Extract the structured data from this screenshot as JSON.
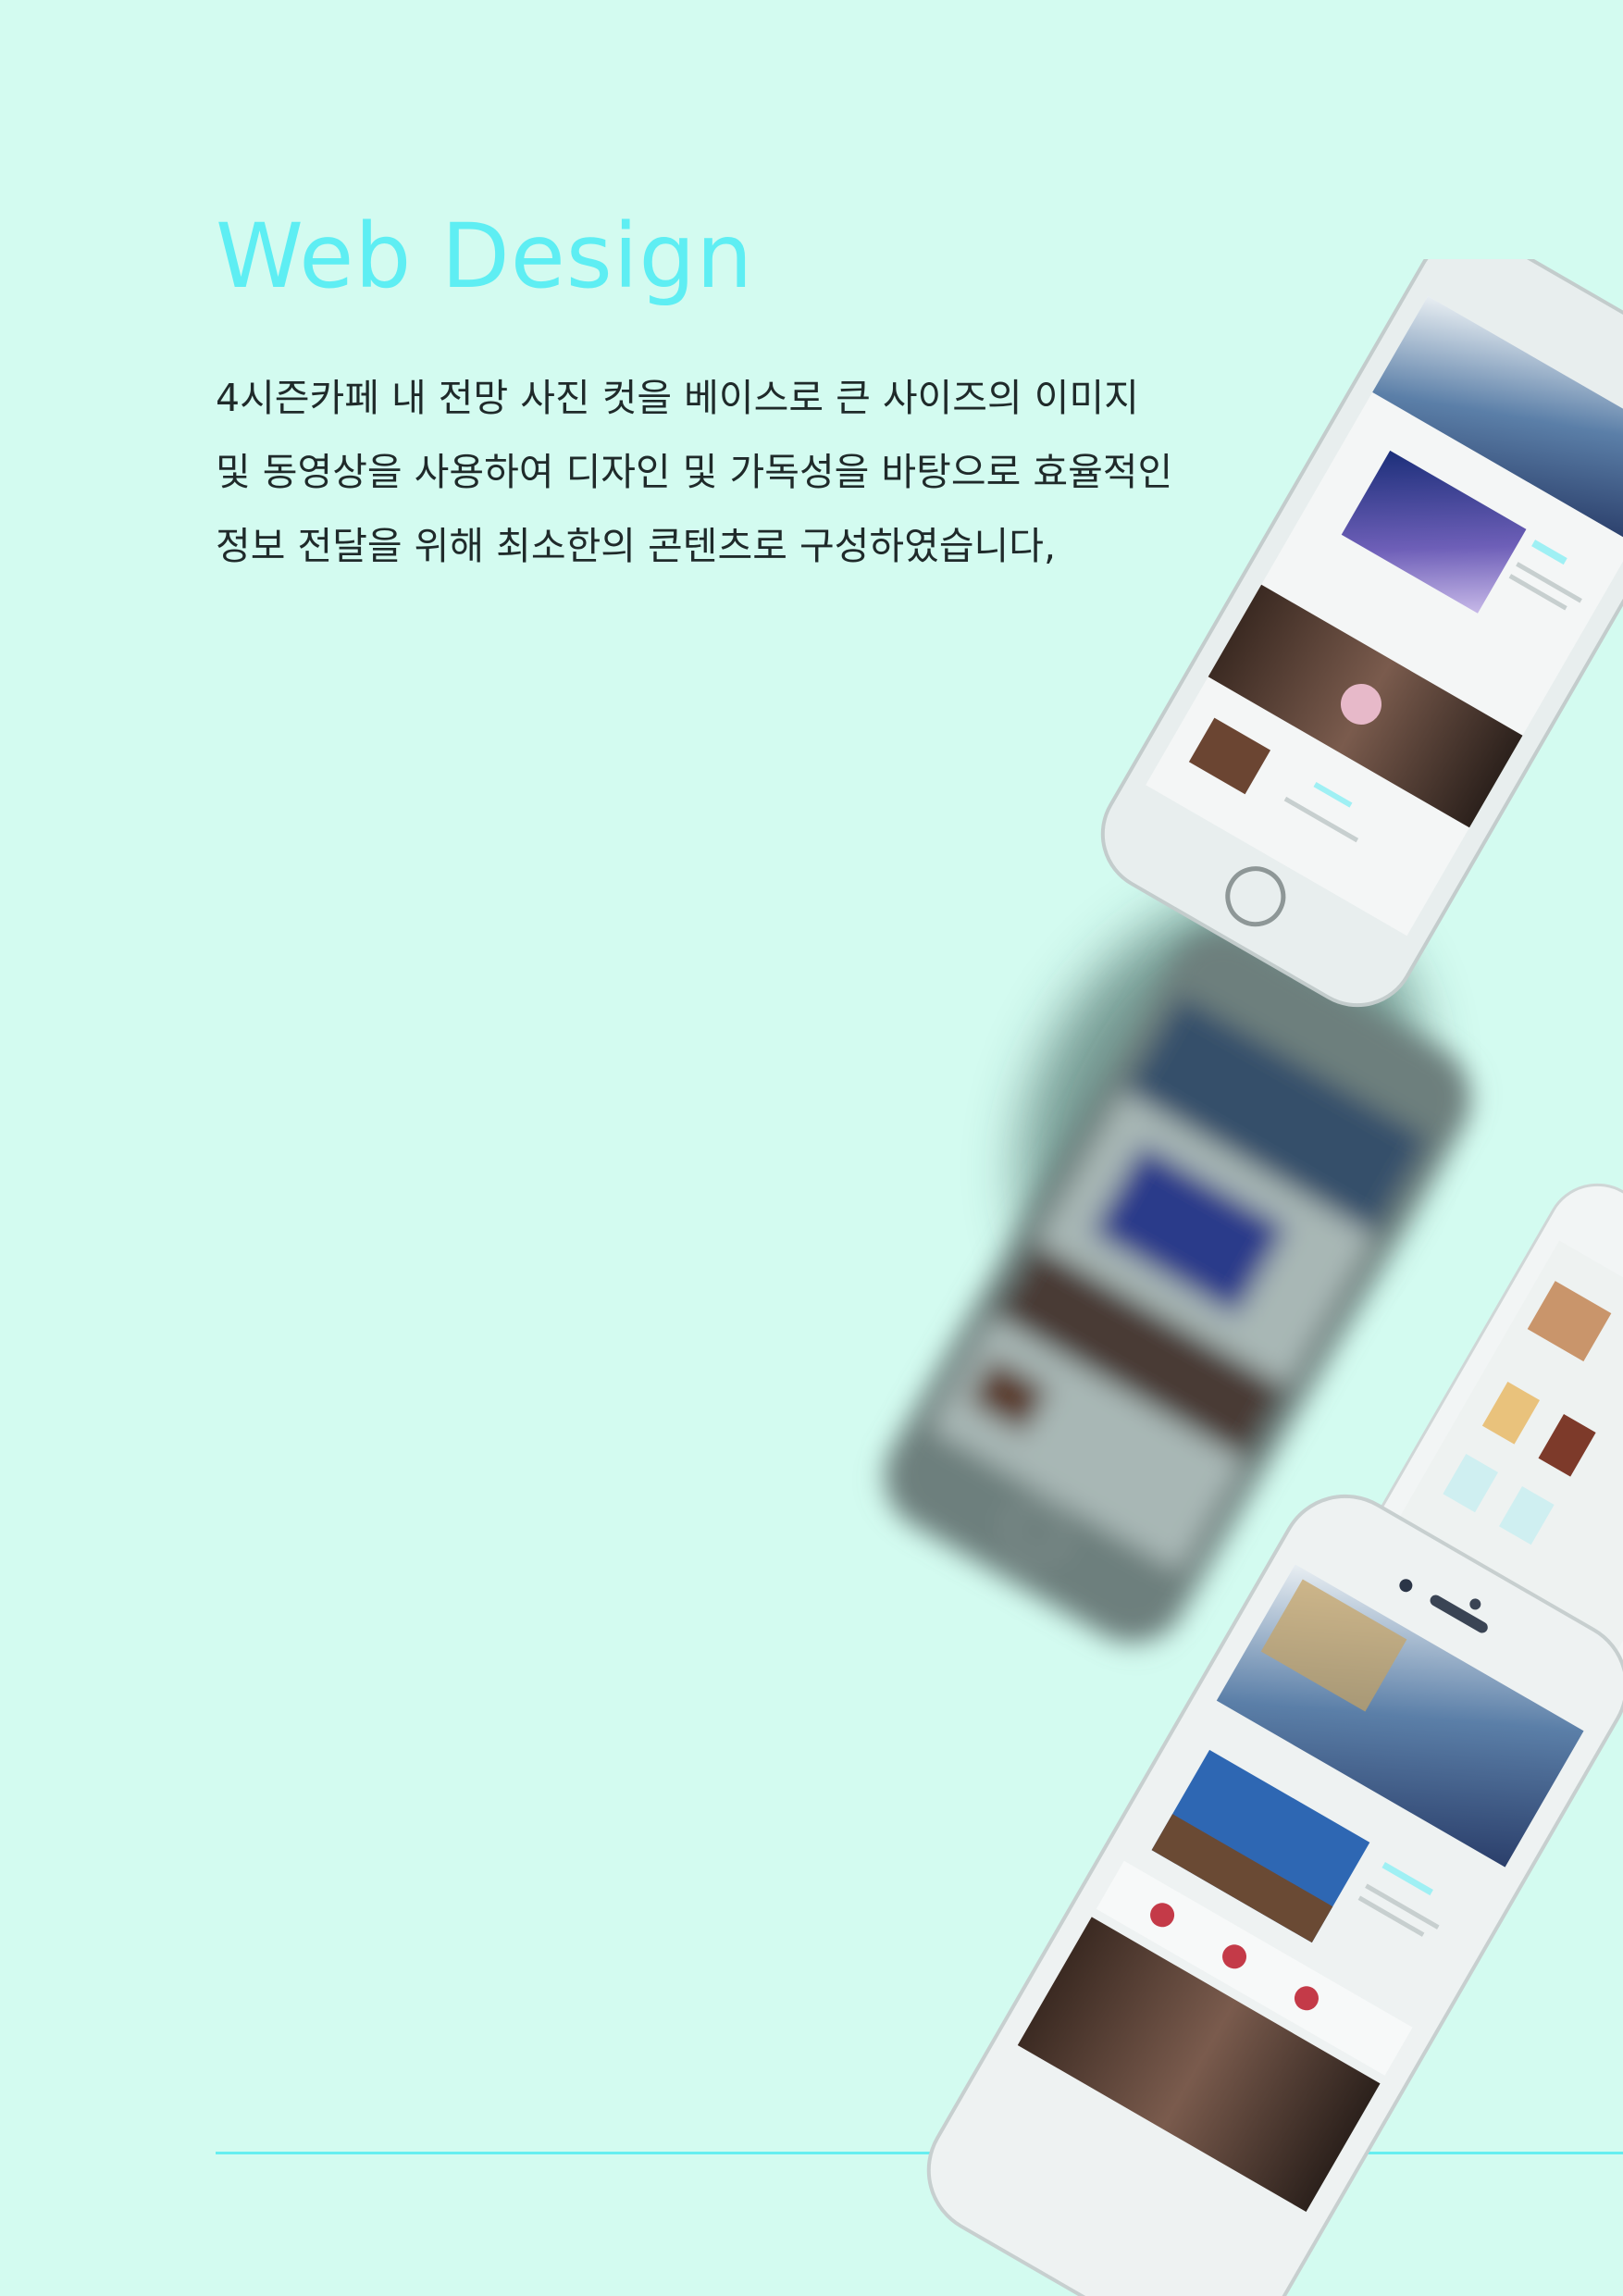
{
  "header": {
    "title": "Web Design"
  },
  "content": {
    "description": "4시즌카페 내 전망 사진 컷을 베이스로 큰 사이즈의 이미지 및 동영상을 사용하여 디자인 및 가독성을 바탕으로 효율적인 정보 전달을 위해 최소한의 콘텐츠로 구성하였습니다,"
  },
  "colors": {
    "background": "#d3fbf0",
    "accent": "#5eeef3",
    "text": "#1f2a2a"
  },
  "illustration": {
    "subject": "smartphone mockups showing cafe website",
    "devices": [
      "phone-mockup-top",
      "phone-mockup-blurred",
      "phone-mockup-right",
      "phone-mockup-bottom"
    ]
  }
}
